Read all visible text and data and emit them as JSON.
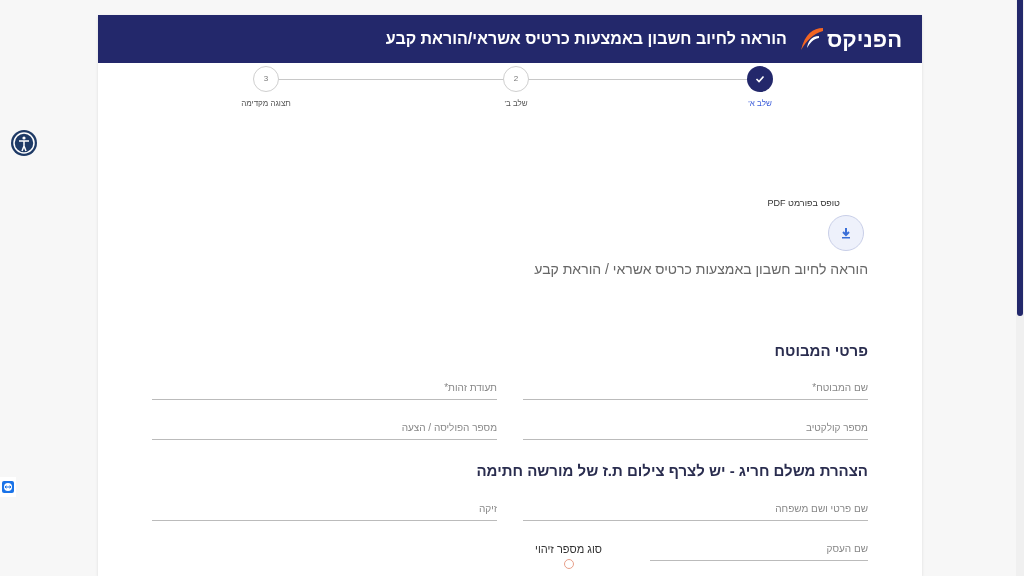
{
  "header": {
    "logo_text": "הפניקס",
    "title": "הוראה לחיוב חשבון באמצעות כרטיס אשראי/הוראת קבע"
  },
  "steps": [
    {
      "label": "שלב א'",
      "completed": true
    },
    {
      "label": "שלב ב'",
      "completed": false,
      "number": "2"
    },
    {
      "label": "תצוגה מקדימה",
      "completed": false,
      "number": "3"
    }
  ],
  "pdf": {
    "label": "טופס בפורמט PDF",
    "title": "הוראה לחיוב חשבון באמצעות כרטיס אשראי / הוראת קבע"
  },
  "sections": [
    {
      "heading": "פרטי המבוטח",
      "fields": [
        {
          "kind": "text",
          "placeholder": "שם המבוטח*"
        },
        {
          "kind": "text",
          "placeholder": "תעודת זהות*"
        },
        {
          "kind": "text",
          "placeholder": "מספר קולקטיב"
        },
        {
          "kind": "text",
          "placeholder": "מספר הפוליסה / הצעה"
        }
      ]
    },
    {
      "heading": "הצהרת משלם חריג - יש לצרף צילום ת.ז של מורשה חתימה",
      "fields": [
        {
          "kind": "text",
          "placeholder": "שם פרטי ושם משפחה"
        },
        {
          "kind": "text",
          "placeholder": "זיקה"
        },
        {
          "kind": "short",
          "placeholder": "שם העסק"
        },
        {
          "kind": "choice",
          "label": "סוג מספר זיהוי",
          "selected": false
        }
      ]
    }
  ]
}
